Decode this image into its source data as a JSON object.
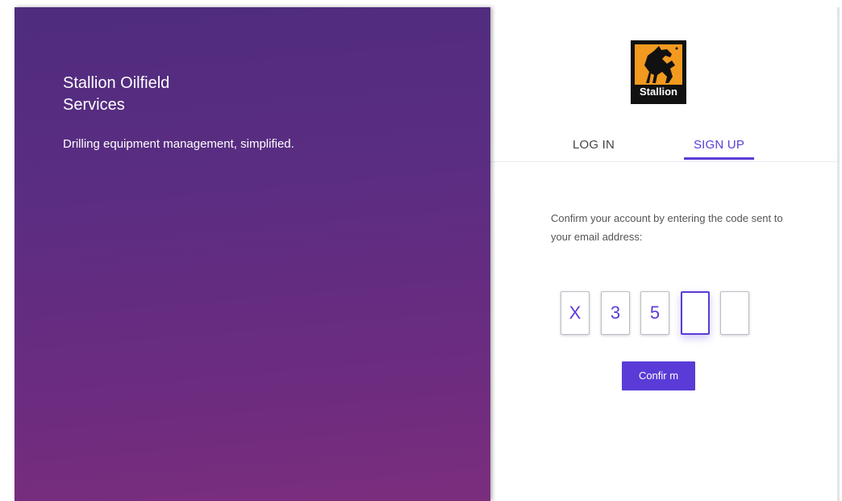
{
  "hero": {
    "title": "Stallion Oilfield Services",
    "tagline": "Drilling equipment management, simplified."
  },
  "logo": {
    "word": "Stallion",
    "icon": "horse-icon"
  },
  "tabs": [
    {
      "label": "LOG IN",
      "active": false
    },
    {
      "label": "SIGN UP",
      "active": true
    }
  ],
  "confirm": {
    "instructions": "Confirm your account by entering the code sent to your email address:",
    "code_digits": [
      "X",
      "3",
      "5",
      "",
      ""
    ],
    "button_label": "Confir m"
  },
  "colors": {
    "accent": "#5b3bd7",
    "hero_top": "#4f2c7e",
    "hero_bottom": "#7b2d7d",
    "logo_orange": "#f29a1f"
  }
}
